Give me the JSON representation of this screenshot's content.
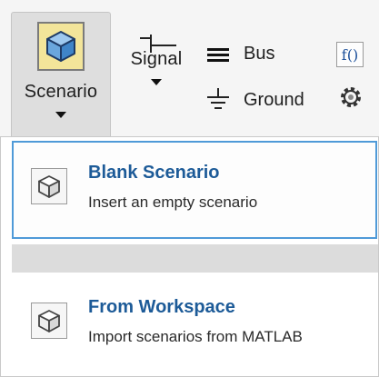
{
  "toolstrip": {
    "scenario_label": "Scenario",
    "signal_label": "Signal",
    "bus_label": "Bus",
    "ground_label": "Ground",
    "fx_label": "f()"
  },
  "menu": {
    "items": [
      {
        "title": "Blank Scenario",
        "description": "Insert an empty scenario",
        "icon": "cube-icon"
      },
      {
        "title": "From Workspace",
        "description": "Import scenarios from MATLAB",
        "icon": "cube-icon"
      }
    ]
  },
  "colors": {
    "selected_border": "#4f9ad8",
    "title_blue": "#1d5b98",
    "cube_bg": "#f3e59a",
    "separator": "#dcdcdc"
  }
}
